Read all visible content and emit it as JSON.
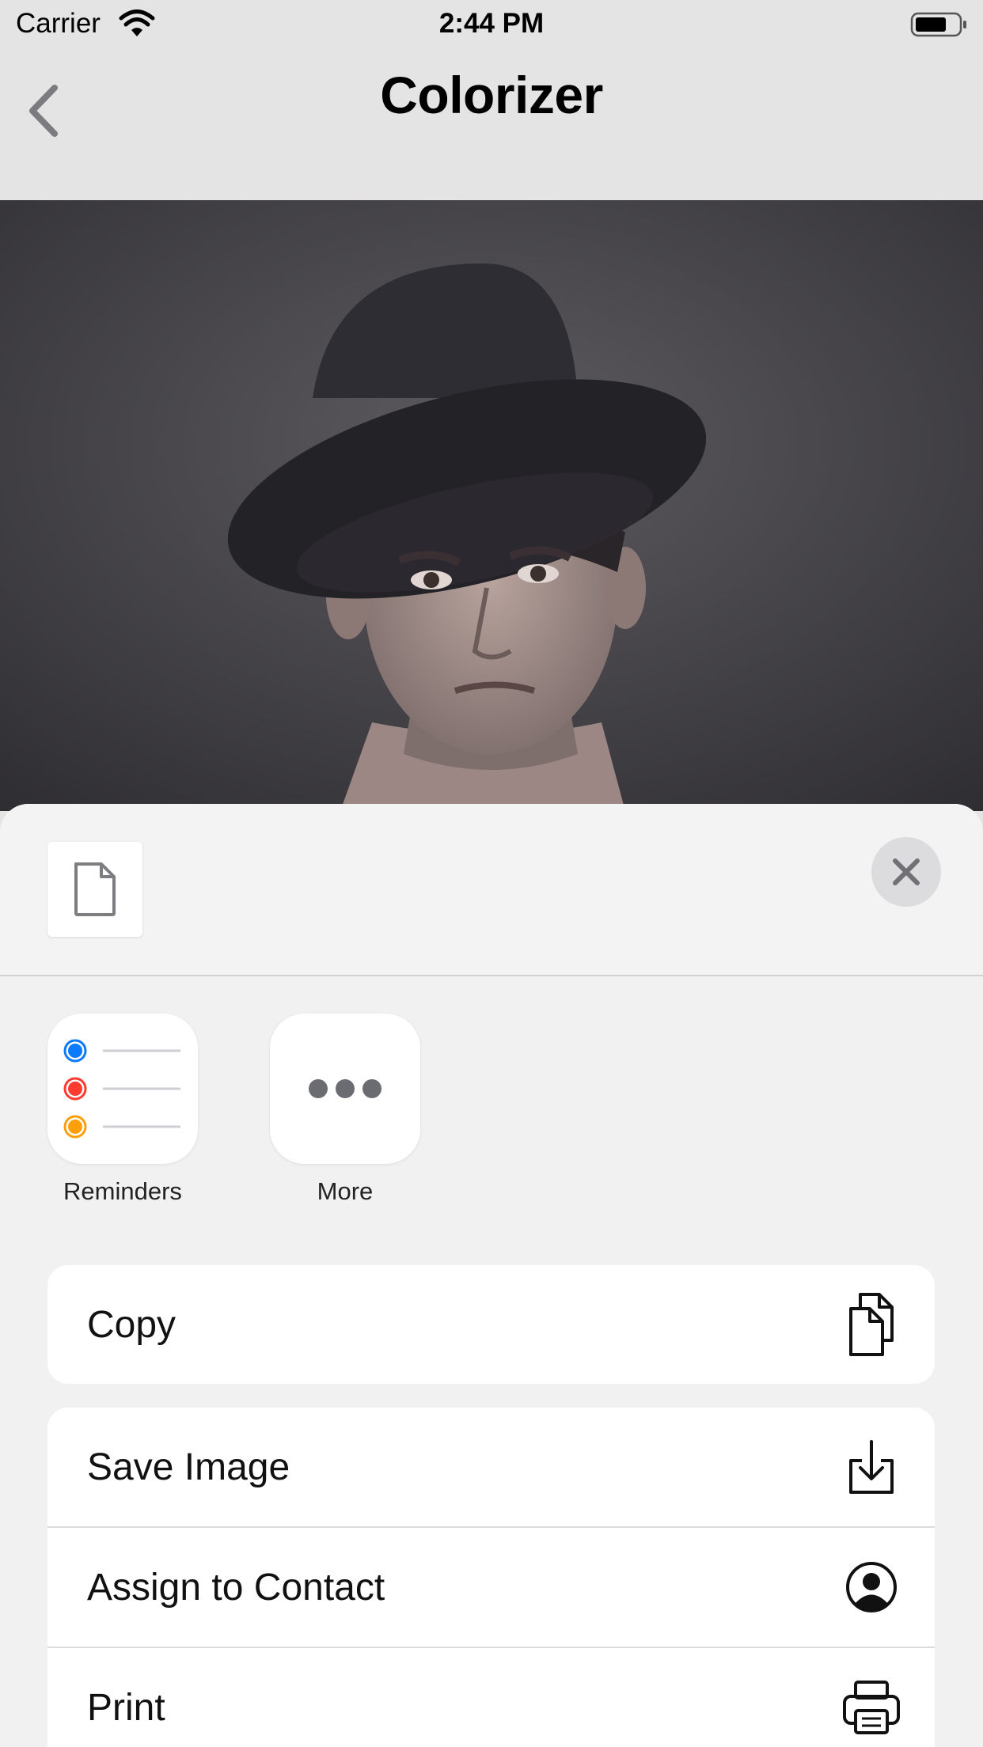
{
  "status_bar": {
    "carrier": "Carrier",
    "time": "2:44 PM"
  },
  "nav": {
    "title": "Colorizer",
    "back_icon": "chevron-left-icon"
  },
  "photo": {
    "description_icon": "portrait-photo"
  },
  "share_sheet": {
    "apps": [
      {
        "label": "Reminders",
        "icon": "reminders-icon"
      },
      {
        "label": "More",
        "icon": "more-icon"
      }
    ],
    "actions_group1": [
      {
        "label": "Copy",
        "icon": "copy-icon"
      }
    ],
    "actions_group2": [
      {
        "label": "Save Image",
        "icon": "save-image-icon"
      },
      {
        "label": "Assign to Contact",
        "icon": "contact-icon"
      },
      {
        "label": "Print",
        "icon": "print-icon"
      }
    ]
  },
  "colors": {
    "reminder_blue": "#0a7bff",
    "reminder_red": "#ff3b30",
    "reminder_orange": "#ff9f0a",
    "sheet_bg": "#f2f1f2"
  }
}
